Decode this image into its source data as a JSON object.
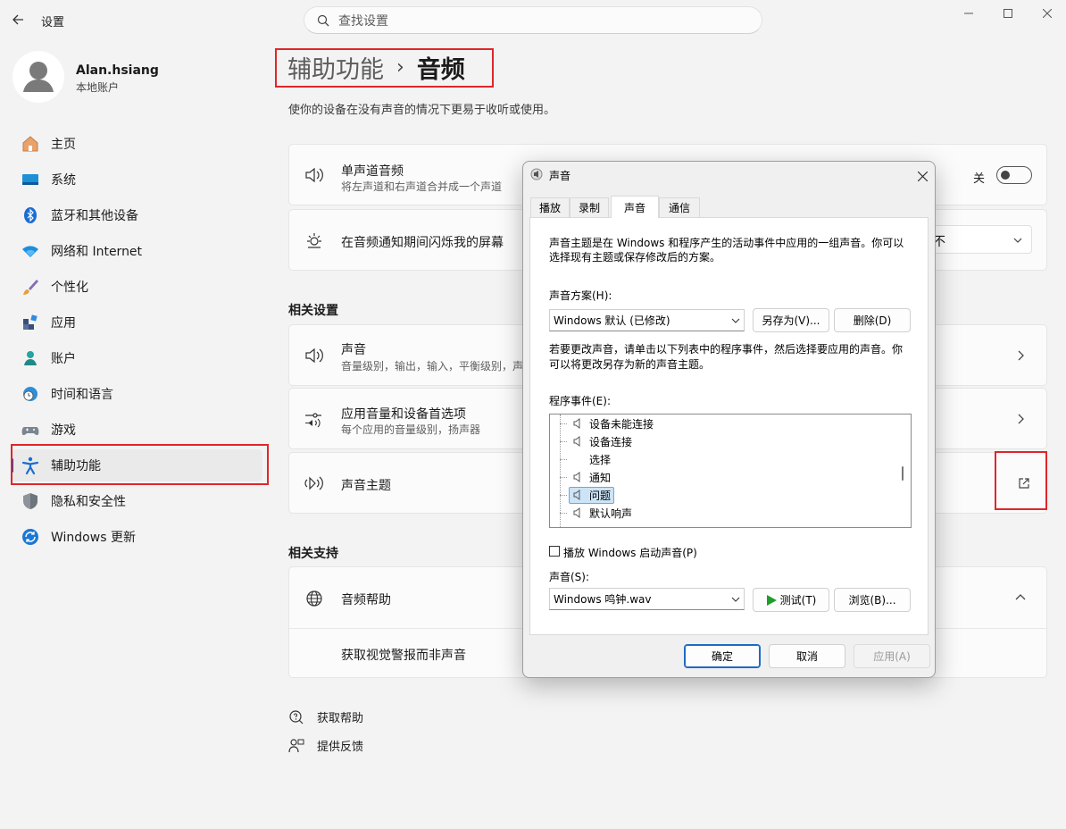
{
  "window": {
    "title": "设置"
  },
  "search": {
    "placeholder": "查找设置"
  },
  "user": {
    "name": "Alan.hsiang",
    "type": "本地账户"
  },
  "nav": [
    {
      "label": "主页"
    },
    {
      "label": "系统"
    },
    {
      "label": "蓝牙和其他设备"
    },
    {
      "label": "网络和 Internet"
    },
    {
      "label": "个性化"
    },
    {
      "label": "应用"
    },
    {
      "label": "账户"
    },
    {
      "label": "时间和语言"
    },
    {
      "label": "游戏"
    },
    {
      "label": "辅助功能"
    },
    {
      "label": "隐私和安全性"
    },
    {
      "label": "Windows 更新"
    }
  ],
  "breadcrumb": {
    "parent": "辅助功能",
    "sep": "›",
    "current": "音频"
  },
  "page": {
    "description": "使你的设备在没有声音的情况下更易于收听或使用。"
  },
  "mono": {
    "title": "单声道音频",
    "subtitle": "将左声道和右声道合并成一个声道",
    "toggle_label": "关"
  },
  "flash": {
    "title": "在音频通知期间闪烁我的屏幕",
    "dropdown_value": "不"
  },
  "related": {
    "heading": "相关设置",
    "sound": {
      "title": "声音",
      "subtitle": "音量级别，输出，输入，平衡级别，声"
    },
    "appvol": {
      "title": "应用音量和设备首选项",
      "subtitle": "每个应用的音量级别，扬声器"
    },
    "theme": {
      "title": "声音主题"
    }
  },
  "support": {
    "heading": "相关支持",
    "help_title": "音频帮助",
    "link": "获取视觉警报而非声音"
  },
  "footer": {
    "help": "获取帮助",
    "feedback": "提供反馈"
  },
  "dialog": {
    "title": "声音",
    "tabs": [
      "播放",
      "录制",
      "声音",
      "通信"
    ],
    "intro": [
      "声音主题是在 Windows 和程序产生的活动事件中应用的一组声音。你可以",
      "选择现有主题或保存修改后的方案。"
    ],
    "scheme_label": "声音方案(H):",
    "scheme_value": "Windows 默认 (已修改)",
    "save_as": "另存为(V)...",
    "delete": "删除(D)",
    "change_hint": [
      "若要更改声音，请单击以下列表中的程序事件，然后选择要应用的声音。你",
      "可以将更改另存为新的声音主题。"
    ],
    "events_label": "程序事件(E):",
    "events": [
      "设备未能连接",
      "设备连接",
      "选择",
      "通知",
      "问题",
      "默认响声"
    ],
    "startup_checkbox": "播放 Windows 启动声音(P)",
    "sound_label": "声音(S):",
    "sound_value": "Windows 鸣钟.wav",
    "test": "测试(T)",
    "browse": "浏览(B)...",
    "ok": "确定",
    "cancel": "取消",
    "apply": "应用(A)"
  },
  "colors": {
    "accent": "#1f4fae",
    "highlight_red": "#e0262a"
  }
}
